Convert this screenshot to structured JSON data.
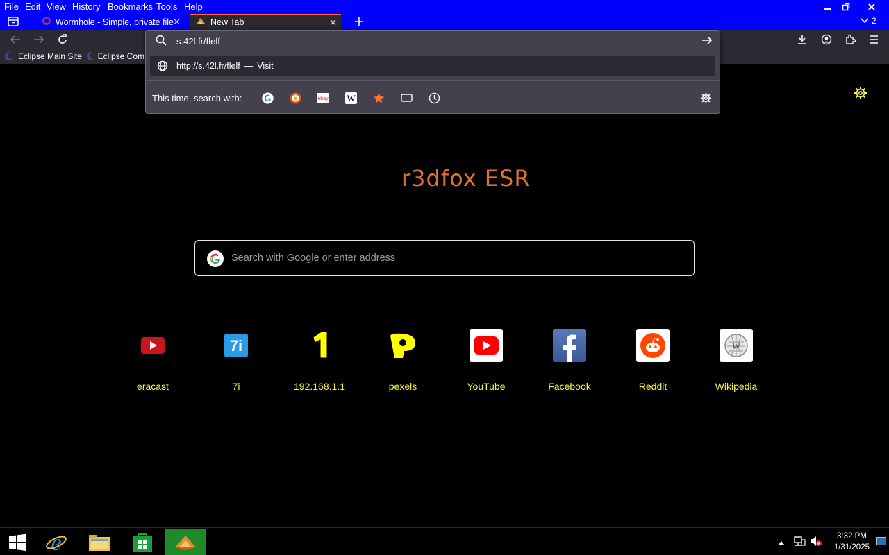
{
  "menubar": {
    "items": [
      "File",
      "Edit",
      "View",
      "History",
      "Bookmarks",
      "Tools",
      "Help"
    ]
  },
  "tabs": [
    {
      "title": "Wormhole - Simple, private file",
      "icon": "wormhole-icon"
    },
    {
      "title": "New Tab",
      "icon": "r3dfox-icon"
    }
  ],
  "tab_count": "2",
  "bookmarks": [
    {
      "label": "Eclipse Main Site"
    },
    {
      "label": "Eclipse Com"
    }
  ],
  "urlbar": {
    "value": "s.42l.fr/flelf",
    "suggestion_url": "http://s.42l.fr/flelf",
    "suggestion_dash": "—",
    "suggestion_action": "Visit",
    "search_with": "This time, search with:"
  },
  "brand": "r3dfox ESR",
  "search": {
    "placeholder": "Search with Google or enter address"
  },
  "top_sites": [
    {
      "label": "eracast",
      "icon": "eracast-icon"
    },
    {
      "label": "7i",
      "icon": "7i-icon"
    },
    {
      "label": "192.168.1.1",
      "icon": "number-one-icon"
    },
    {
      "label": "pexels",
      "icon": "pexels-icon"
    },
    {
      "label": "YouTube",
      "icon": "youtube-icon"
    },
    {
      "label": "Facebook",
      "icon": "facebook-icon"
    },
    {
      "label": "Reddit",
      "icon": "reddit-icon"
    },
    {
      "label": "Wikipedia",
      "icon": "wikipedia-icon"
    }
  ],
  "clock": {
    "time": "3:32 PM",
    "date": "1/31/2025"
  },
  "colors": {
    "titlebar": "#0000ff",
    "toolbar": "#2b2a33",
    "brand": "#e0722c",
    "site_label": "#f5f542"
  }
}
